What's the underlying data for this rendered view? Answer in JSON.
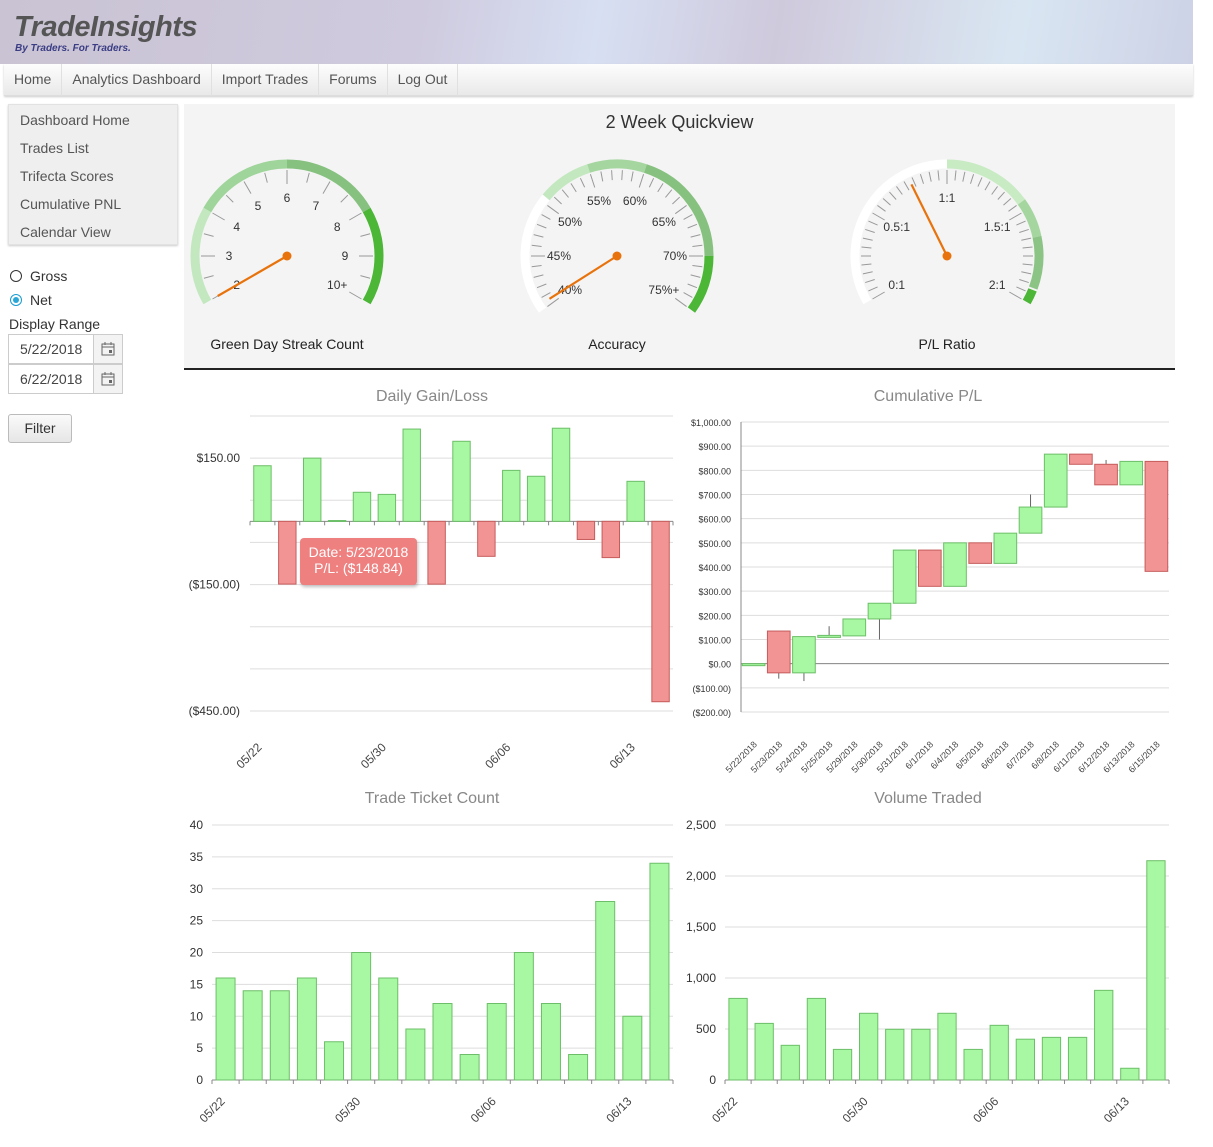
{
  "header": {
    "logo": "TradeInsights",
    "tagline": "By Traders. For Traders."
  },
  "nav": {
    "items": [
      "Home",
      "Analytics Dashboard",
      "Import Trades",
      "Forums",
      "Log Out"
    ]
  },
  "sidebar": {
    "items": [
      "Dashboard Home",
      "Trades List",
      "Trifecta Scores",
      "Cumulative PNL",
      "Calendar View"
    ]
  },
  "filters": {
    "gross_label": "Gross",
    "net_label": "Net",
    "selected": "Net",
    "range_label": "Display Range",
    "start_date": "5/22/2018",
    "end_date": "6/22/2018",
    "filter_button": "Filter",
    "calendar_icon": "calendar-icon"
  },
  "quickview": {
    "title": "2 Week Quickview",
    "gauges": [
      {
        "label": "Green Day Streak Count",
        "min": 2,
        "max": 10,
        "value": 2,
        "ticks": [
          {
            "v": 2,
            "t": "2"
          },
          {
            "v": 3,
            "t": "3"
          },
          {
            "v": 4,
            "t": "4"
          },
          {
            "v": 5,
            "t": "5"
          },
          {
            "v": 6,
            "t": "6"
          },
          {
            "v": 7,
            "t": "7"
          },
          {
            "v": 8,
            "t": "8"
          },
          {
            "v": 9,
            "t": "9"
          },
          {
            "v": 10,
            "t": "10+"
          }
        ],
        "bands": [
          {
            "from": 2,
            "to": 4,
            "color": "#c3e8c0"
          },
          {
            "from": 4,
            "to": 6,
            "color": "#9fd49a"
          },
          {
            "from": 6,
            "to": 8,
            "color": "#86c17f"
          },
          {
            "from": 8,
            "to": 10,
            "color": "#4cb636"
          }
        ]
      },
      {
        "label": "Accuracy",
        "min": 40,
        "max": 75,
        "value": 40.5,
        "ticks": [
          {
            "v": 40,
            "t": "40%"
          },
          {
            "v": 45,
            "t": "45%"
          },
          {
            "v": 50,
            "t": "50%"
          },
          {
            "v": 55,
            "t": "55%"
          },
          {
            "v": 60,
            "t": "60%"
          },
          {
            "v": 65,
            "t": "65%"
          },
          {
            "v": 70,
            "t": "70%"
          },
          {
            "v": 75,
            "t": "75%+"
          }
        ],
        "bands": [
          {
            "from": 40,
            "to": 50.5,
            "color": "#ffffff"
          },
          {
            "from": 50.5,
            "to": 55,
            "color": "#c3e8c0"
          },
          {
            "from": 55,
            "to": 60,
            "color": "#a5d6a0"
          },
          {
            "from": 60,
            "to": 70,
            "color": "#86c17f"
          },
          {
            "from": 70,
            "to": 75,
            "color": "#4cb636"
          }
        ]
      },
      {
        "label": "P/L Ratio",
        "min": 0,
        "max": 2,
        "value": 0.78,
        "ticks": [
          {
            "v": 0,
            "t": "0:1"
          },
          {
            "v": 0.5,
            "t": "0.5:1"
          },
          {
            "v": 1,
            "t": "1:1"
          },
          {
            "v": 1.5,
            "t": "1.5:1"
          },
          {
            "v": 2,
            "t": "2:1"
          }
        ],
        "bands": [
          {
            "from": 0,
            "to": 1,
            "color": "#ffffff"
          },
          {
            "from": 1,
            "to": 1.45,
            "color": "#c8ebc4"
          },
          {
            "from": 1.45,
            "to": 1.65,
            "color": "#a5d6a0"
          },
          {
            "from": 1.65,
            "to": 1.92,
            "color": "#8cc485"
          },
          {
            "from": 1.93,
            "to": 2,
            "color": "#4cb636"
          }
        ]
      }
    ],
    "needle_color": "#e8730c"
  },
  "tooltip": {
    "date": "Date: 5/23/2018",
    "pl": "P/L: ($148.84)"
  },
  "colors": {
    "gain": "#a8f7a2",
    "gain_border": "#6cbf68",
    "loss": "#f29494",
    "loss_border": "#c65c5c"
  },
  "chart_data": [
    {
      "id": "daily",
      "type": "bar",
      "title": "Daily Gain/Loss",
      "ylim": [
        -450,
        250
      ],
      "grid": true,
      "yticklabels": [
        {
          "v": 150,
          "t": "$150.00"
        },
        {
          "v": -150,
          "t": "($150.00)"
        },
        {
          "v": -450,
          "t": "($450.00)"
        }
      ],
      "xticklabels": [
        {
          "i": 0,
          "t": "05/22"
        },
        {
          "i": 5,
          "t": "05/30"
        },
        {
          "i": 10,
          "t": "06/06"
        },
        {
          "i": 15,
          "t": "06/13"
        }
      ],
      "values": [
        132,
        -148.84,
        150,
        2,
        69,
        64,
        219,
        -149,
        190,
        -83,
        121,
        107,
        221,
        -43,
        -86,
        95,
        -428
      ]
    },
    {
      "id": "cumulative",
      "type": "candlestick",
      "title": "Cumulative P/L",
      "ylim": [
        -200,
        1000
      ],
      "grid": true,
      "yticklabels": [
        {
          "v": 1000,
          "t": "$1,000.00"
        },
        {
          "v": 900,
          "t": "$900.00"
        },
        {
          "v": 800,
          "t": "$800.00"
        },
        {
          "v": 700,
          "t": "$700.00"
        },
        {
          "v": 600,
          "t": "$600.00"
        },
        {
          "v": 500,
          "t": "$500.00"
        },
        {
          "v": 400,
          "t": "$400.00"
        },
        {
          "v": 300,
          "t": "$300.00"
        },
        {
          "v": 200,
          "t": "$200.00"
        },
        {
          "v": 100,
          "t": "$100.00"
        },
        {
          "v": 0,
          "t": "$0.00"
        },
        {
          "v": -100,
          "t": "($100.00)"
        },
        {
          "v": -200,
          "t": "($200.00)"
        }
      ],
      "categories": [
        "5/22/2018",
        "5/23/2018",
        "5/24/2018",
        "5/25/2018",
        "5/29/2018",
        "5/30/2018",
        "5/31/2018",
        "6/1/2018",
        "6/4/2018",
        "6/5/2018",
        "6/6/2018",
        "6/7/2018",
        "6/8/2018",
        "6/11/2018",
        "6/12/2018",
        "6/13/2018",
        "6/15/2018"
      ],
      "ohlc": [
        [
          0,
          135,
          135,
          0
        ],
        [
          135,
          135,
          -62,
          -38
        ],
        [
          -38,
          112,
          -72,
          112
        ],
        [
          112,
          155,
          110,
          117
        ],
        [
          115,
          185,
          115,
          185
        ],
        [
          185,
          250,
          100,
          250
        ],
        [
          250,
          470,
          250,
          470
        ],
        [
          470,
          470,
          320,
          320
        ],
        [
          320,
          500,
          320,
          500
        ],
        [
          500,
          500,
          415,
          415
        ],
        [
          415,
          540,
          415,
          540
        ],
        [
          540,
          700,
          540,
          648
        ],
        [
          648,
          867,
          648,
          867
        ],
        [
          867,
          867,
          825,
          825
        ],
        [
          825,
          843,
          740,
          740
        ],
        [
          740,
          837,
          740,
          837
        ],
        [
          837,
          837,
          382,
          382
        ]
      ]
    },
    {
      "id": "tickets",
      "type": "bar",
      "title": "Trade Ticket Count",
      "ylim": [
        0,
        40
      ],
      "grid": true,
      "yticklabels": [
        {
          "v": 40,
          "t": "40"
        },
        {
          "v": 35,
          "t": "35"
        },
        {
          "v": 30,
          "t": "30"
        },
        {
          "v": 25,
          "t": "25"
        },
        {
          "v": 20,
          "t": "20"
        },
        {
          "v": 15,
          "t": "15"
        },
        {
          "v": 10,
          "t": "10"
        },
        {
          "v": 5,
          "t": "5"
        },
        {
          "v": 0,
          "t": "0"
        }
      ],
      "xticklabels": [
        {
          "i": 0,
          "t": "05/22"
        },
        {
          "i": 5,
          "t": "05/30"
        },
        {
          "i": 10,
          "t": "06/06"
        },
        {
          "i": 15,
          "t": "06/13"
        }
      ],
      "values": [
        16,
        14,
        14,
        16,
        6,
        20,
        16,
        8,
        12,
        4,
        12,
        20,
        12,
        4,
        28,
        10,
        34
      ]
    },
    {
      "id": "volume",
      "type": "bar",
      "title": "Volume Traded",
      "ylim": [
        0,
        2500
      ],
      "grid": true,
      "yticklabels": [
        {
          "v": 2500,
          "t": "2,500"
        },
        {
          "v": 2000,
          "t": "2,000"
        },
        {
          "v": 1500,
          "t": "1,500"
        },
        {
          "v": 1000,
          "t": "1,000"
        },
        {
          "v": 500,
          "t": "500"
        },
        {
          "v": 0,
          "t": "0"
        }
      ],
      "xticklabels": [
        {
          "i": 0,
          "t": "05/22"
        },
        {
          "i": 5,
          "t": "05/30"
        },
        {
          "i": 10,
          "t": "06/06"
        },
        {
          "i": 15,
          "t": "06/13"
        }
      ],
      "values": [
        800,
        555,
        340,
        800,
        300,
        654,
        497,
        497,
        654,
        300,
        536,
        400,
        418,
        418,
        879,
        115,
        2150
      ]
    }
  ]
}
